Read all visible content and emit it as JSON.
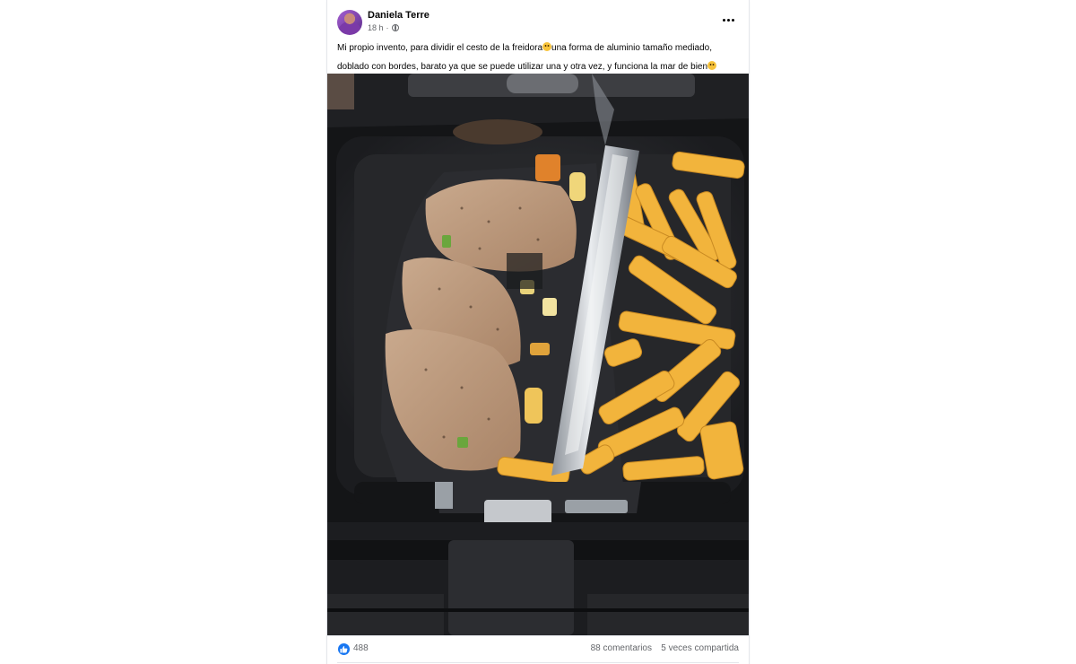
{
  "post": {
    "author": "Daniela Terre",
    "time": "18 h",
    "privacy_icon": "globe-icon",
    "text_part1": "Mi propio invento, para dividir el cesto de la freidora",
    "text_part2": "una forma de aluminio tamaño mediado, doblado con bordes, barato ya que se puede utilizar una y otra vez, y funciona la mar de bien",
    "emoji_icon": "grinning-sweat-emoji-icon",
    "more_icon": "more-horizontal-icon",
    "photo_alt": "Cesta de freidora de aire con filetes, verduras y patatas fritas separados por una lámina de aluminio"
  },
  "reactions": {
    "like_icon": "like-icon",
    "count": "488",
    "comments": "88 comentarios",
    "shares": "5 veces compartida"
  },
  "colors": {
    "brand": "#1877f2",
    "text": "#050505",
    "secondary_text": "#65676b"
  }
}
